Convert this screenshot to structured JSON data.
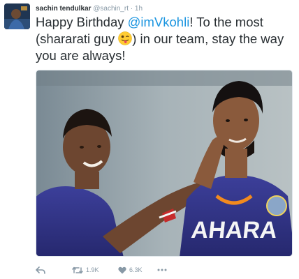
{
  "tweet": {
    "author_name": "sachin tendulkar",
    "author_handle": "@sachin_rt",
    "separator": "·",
    "time": "1h",
    "text_before": "Happy Birthday ",
    "mention": "@imVkohli",
    "text_mid": "! To the most (shararati guy ",
    "text_after": ") in our team, stay the way you are always!",
    "emoji": "winking-tongue-face-emoji"
  },
  "photo": {
    "jersey_text": "AHARA"
  },
  "actions": {
    "reply_icon": "reply-icon",
    "retweet_icon": "retweet-icon",
    "retweet_count": "1.9K",
    "like_icon": "heart-icon",
    "like_count": "6.3K",
    "more_icon": "more-icon"
  },
  "colors": {
    "link": "#1b95e0",
    "muted": "#8899a6",
    "text": "#292f33"
  }
}
